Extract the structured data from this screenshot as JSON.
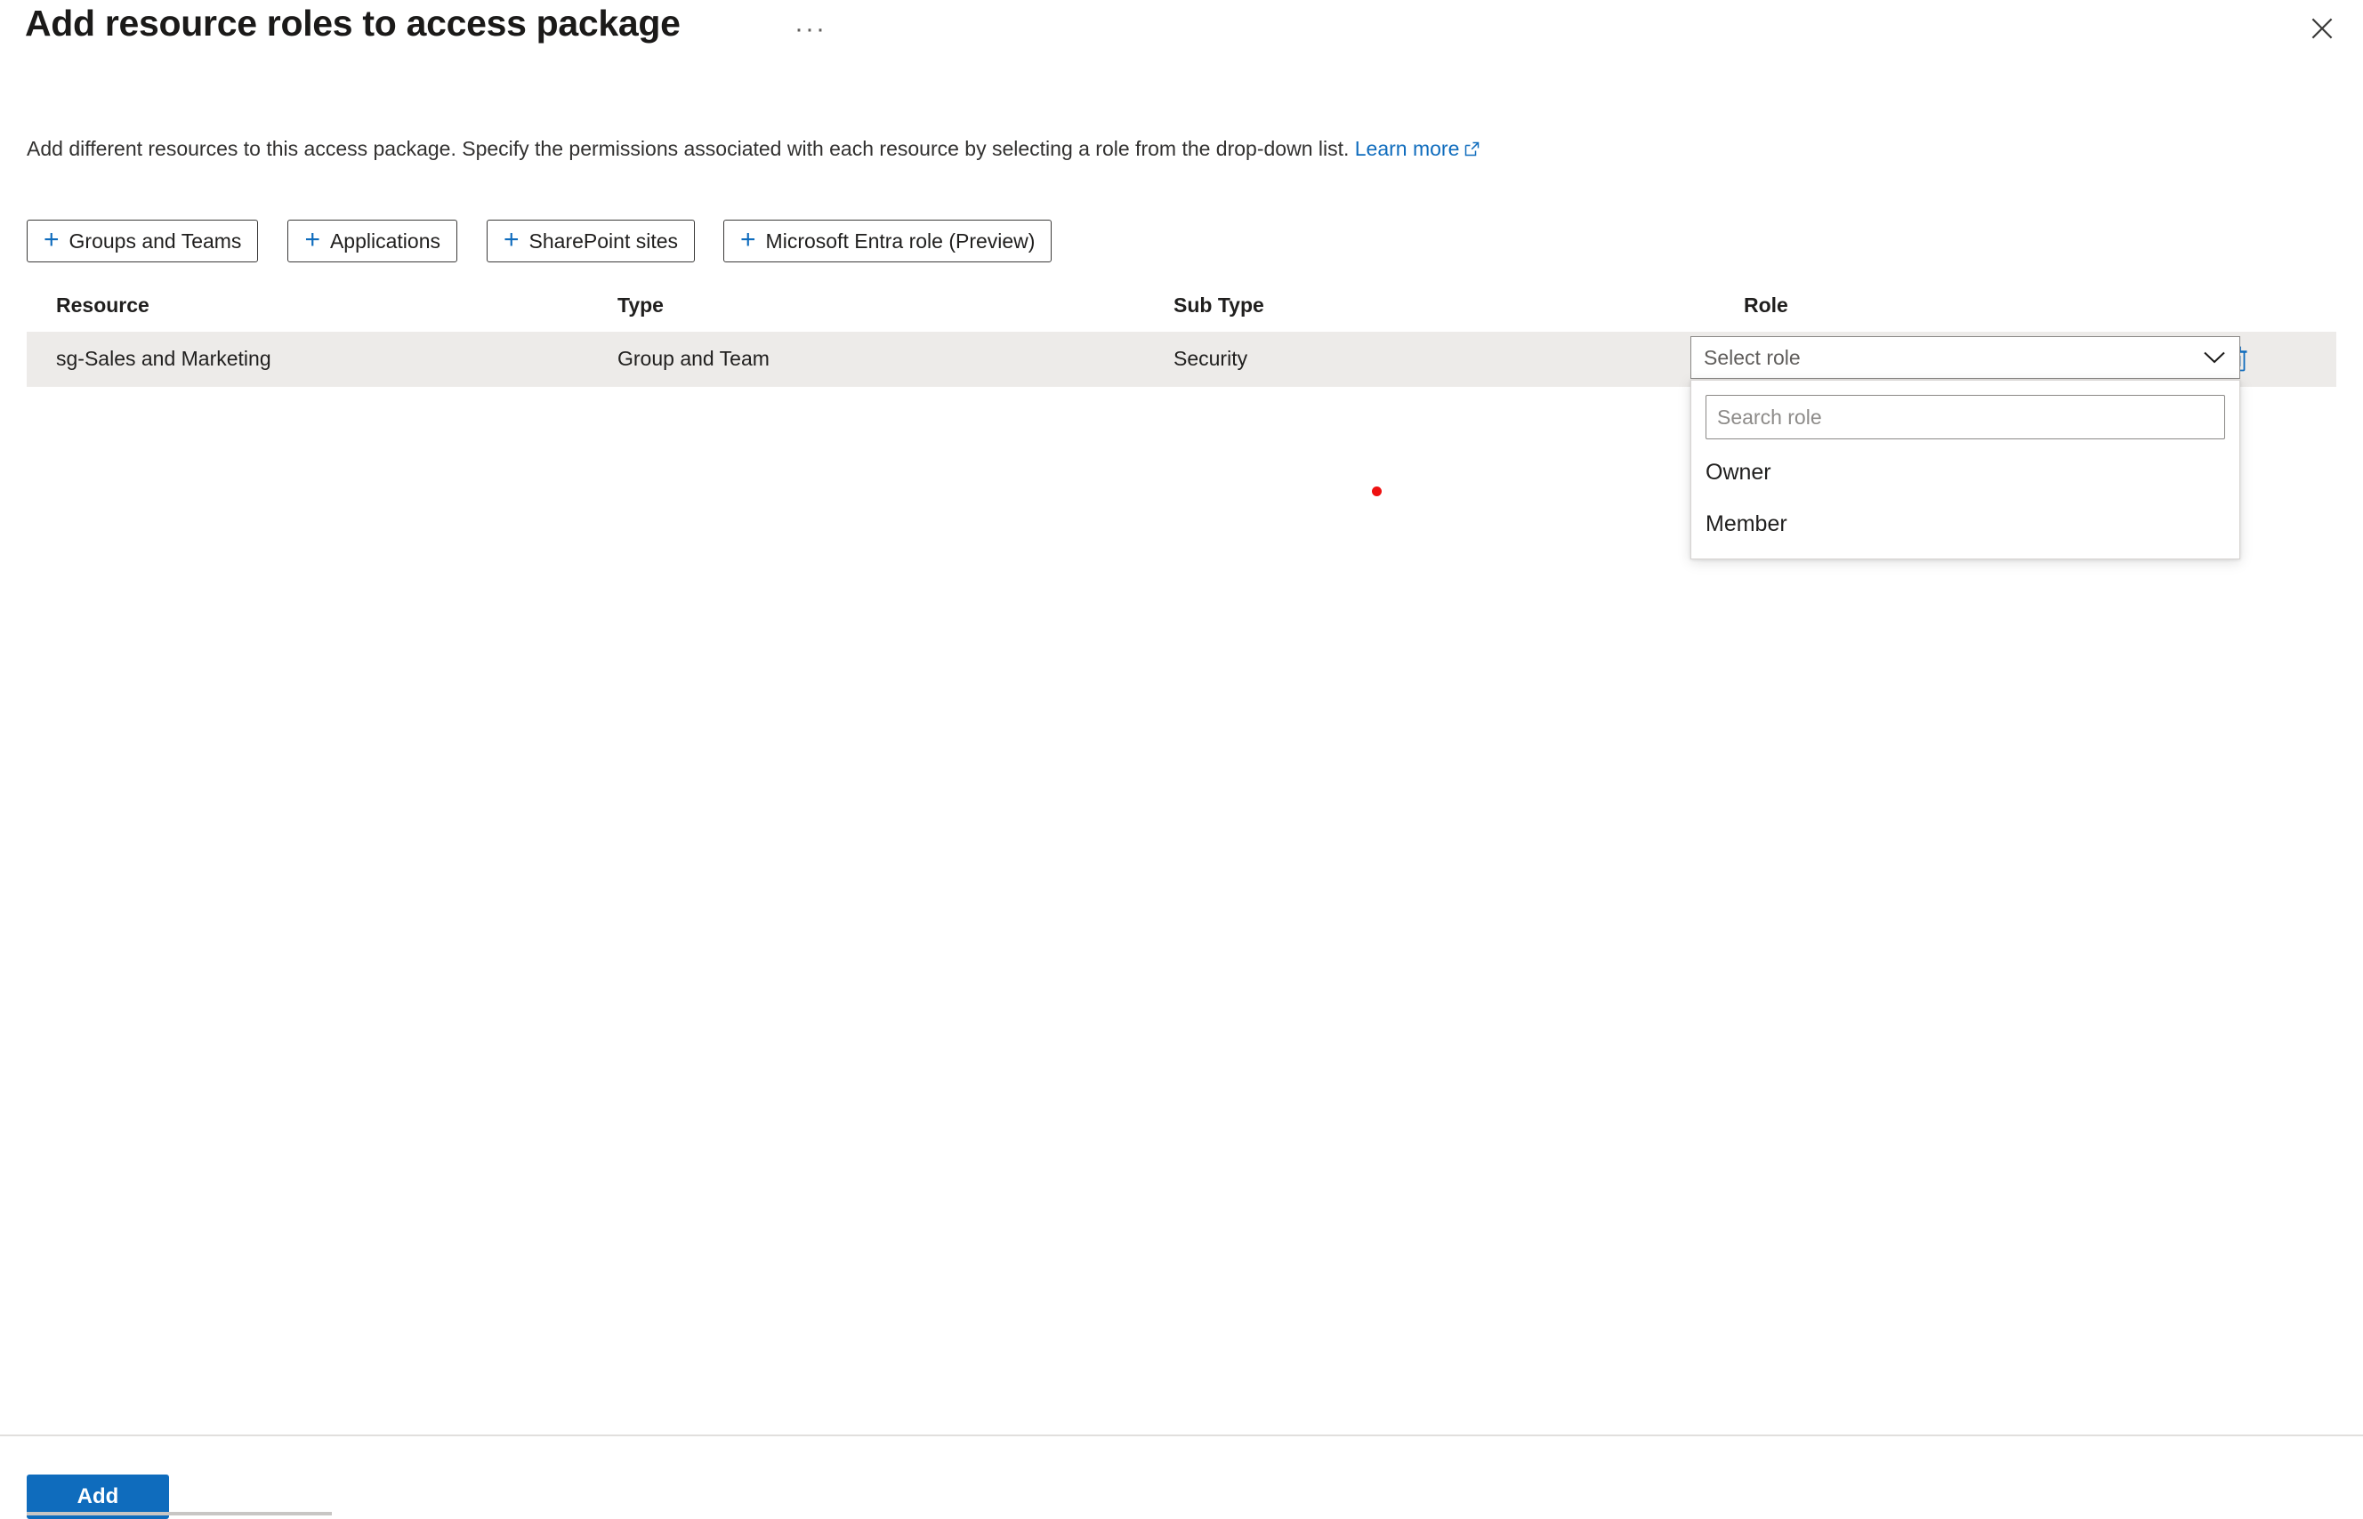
{
  "header": {
    "title": "Add resource roles to access package",
    "more_menu": "···",
    "close_label": "Close"
  },
  "description": {
    "text": "Add different resources to this access package. Specify the permissions associated with each resource by selecting a role from the drop-down list.",
    "link_label": "Learn more"
  },
  "commands": [
    {
      "label": "Groups and Teams",
      "icon": "plus-icon"
    },
    {
      "label": "Applications",
      "icon": "plus-icon"
    },
    {
      "label": "SharePoint sites",
      "icon": "plus-icon"
    },
    {
      "label": "Microsoft Entra role (Preview)",
      "icon": "plus-icon"
    }
  ],
  "table": {
    "columns": [
      "Resource",
      "Type",
      "Sub Type",
      "Role"
    ],
    "rows": [
      {
        "resource": "sg-Sales and Marketing",
        "type": "Group and Team",
        "sub_type": "Security",
        "role_placeholder": "Select role",
        "delete_icon": "trash-icon"
      }
    ]
  },
  "role_dropdown": {
    "open": true,
    "search_placeholder": "Search role",
    "search_value": "",
    "options": [
      "Owner",
      "Member"
    ]
  },
  "footer": {
    "add_label": "Add"
  },
  "colors": {
    "accent": "#0f6cbd",
    "row_background": "#edebe9",
    "border": "#8a8886",
    "text": "#201f1e",
    "marker": "#ee1111"
  }
}
